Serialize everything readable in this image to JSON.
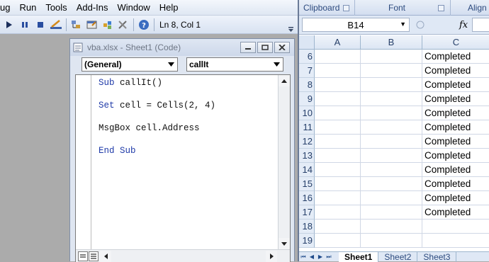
{
  "vbe": {
    "menu": [
      "ug",
      "Run",
      "Tools",
      "Add-Ins",
      "Window",
      "Help"
    ],
    "status": "Ln 8, Col 1",
    "code_window": {
      "title": "vba.xlsx - Sheet1 (Code)",
      "object_combo": "(General)",
      "procedure_combo": "callIt",
      "lines": [
        {
          "keyword": "Sub ",
          "text": "callIt()"
        },
        {
          "keyword": "",
          "text": ""
        },
        {
          "keyword": "Set ",
          "text": "cell = Cells(2, 4)"
        },
        {
          "keyword": "",
          "text": ""
        },
        {
          "keyword": "",
          "text": "MsgBox cell.Address"
        },
        {
          "keyword": "",
          "text": ""
        },
        {
          "keyword": "End Sub",
          "text": ""
        }
      ]
    }
  },
  "excel": {
    "ribbon_groups": [
      "Clipboard",
      "Font",
      "Align"
    ],
    "name_box": "B14",
    "fx_label": "fx",
    "columns": [
      "A",
      "B",
      "C"
    ],
    "rows": [
      {
        "num": "6",
        "C": "Completed"
      },
      {
        "num": "7",
        "C": "Completed"
      },
      {
        "num": "8",
        "C": "Completed"
      },
      {
        "num": "9",
        "C": "Completed"
      },
      {
        "num": "10",
        "C": "Completed"
      },
      {
        "num": "11",
        "C": "Completed"
      },
      {
        "num": "12",
        "C": "Completed"
      },
      {
        "num": "13",
        "C": "Completed"
      },
      {
        "num": "14",
        "C": "Completed"
      },
      {
        "num": "15",
        "C": "Completed"
      },
      {
        "num": "16",
        "C": "Completed"
      },
      {
        "num": "17",
        "C": "Completed"
      },
      {
        "num": "18",
        "C": ""
      },
      {
        "num": "19",
        "C": ""
      }
    ],
    "sheet_tabs": [
      "Sheet1",
      "Sheet2",
      "Sheet3"
    ],
    "active_sheet": "Sheet1"
  }
}
